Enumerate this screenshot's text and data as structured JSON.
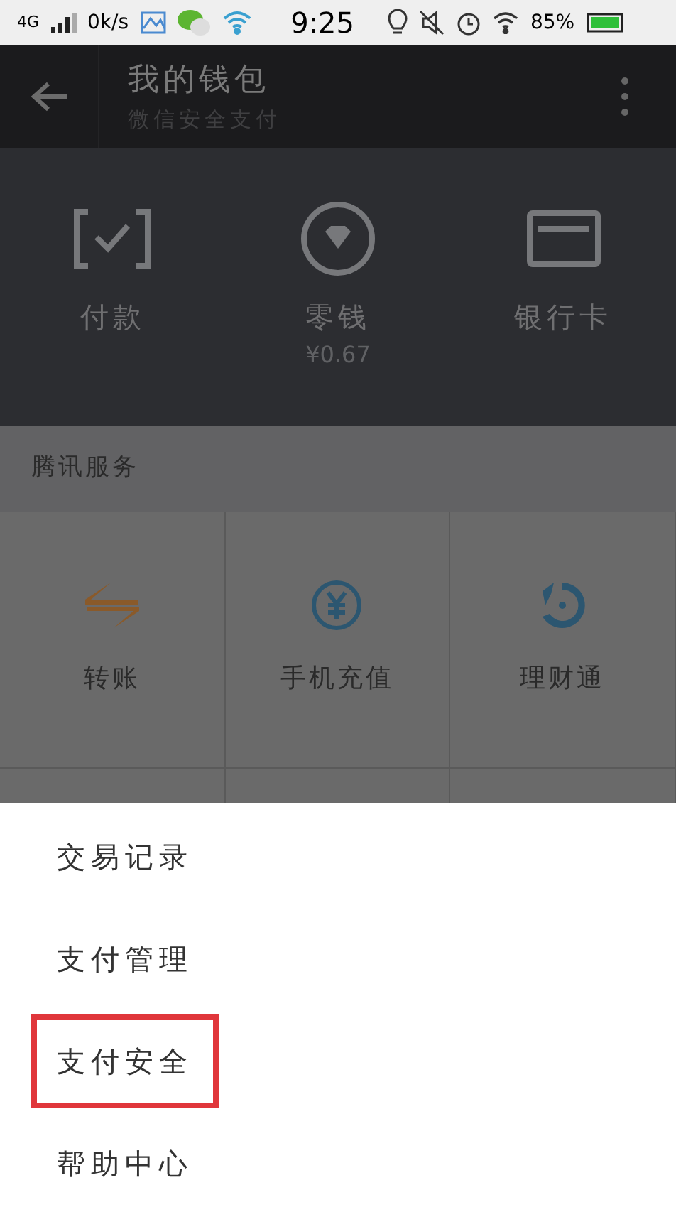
{
  "status_bar": {
    "network": "4G",
    "speed": "0k/s",
    "time": "9:25",
    "battery": "85%"
  },
  "header": {
    "title": "我的钱包",
    "subtitle": "微信安全支付"
  },
  "wallet_items": [
    {
      "kind": "scan",
      "label": "付款"
    },
    {
      "kind": "change",
      "label": "零钱",
      "amount": "¥0.67"
    },
    {
      "kind": "card",
      "label": "银行卡"
    }
  ],
  "section_title": "腾讯服务",
  "services": [
    {
      "kind": "transfer",
      "label": "转账"
    },
    {
      "kind": "topup",
      "label": "手机充值"
    },
    {
      "kind": "wealth",
      "label": "理财通"
    }
  ],
  "menu": [
    {
      "label": "交易记录",
      "highlighted": false
    },
    {
      "label": "支付管理",
      "highlighted": false
    },
    {
      "label": "支付安全",
      "highlighted": true
    },
    {
      "label": "帮助中心",
      "highlighted": false
    }
  ]
}
